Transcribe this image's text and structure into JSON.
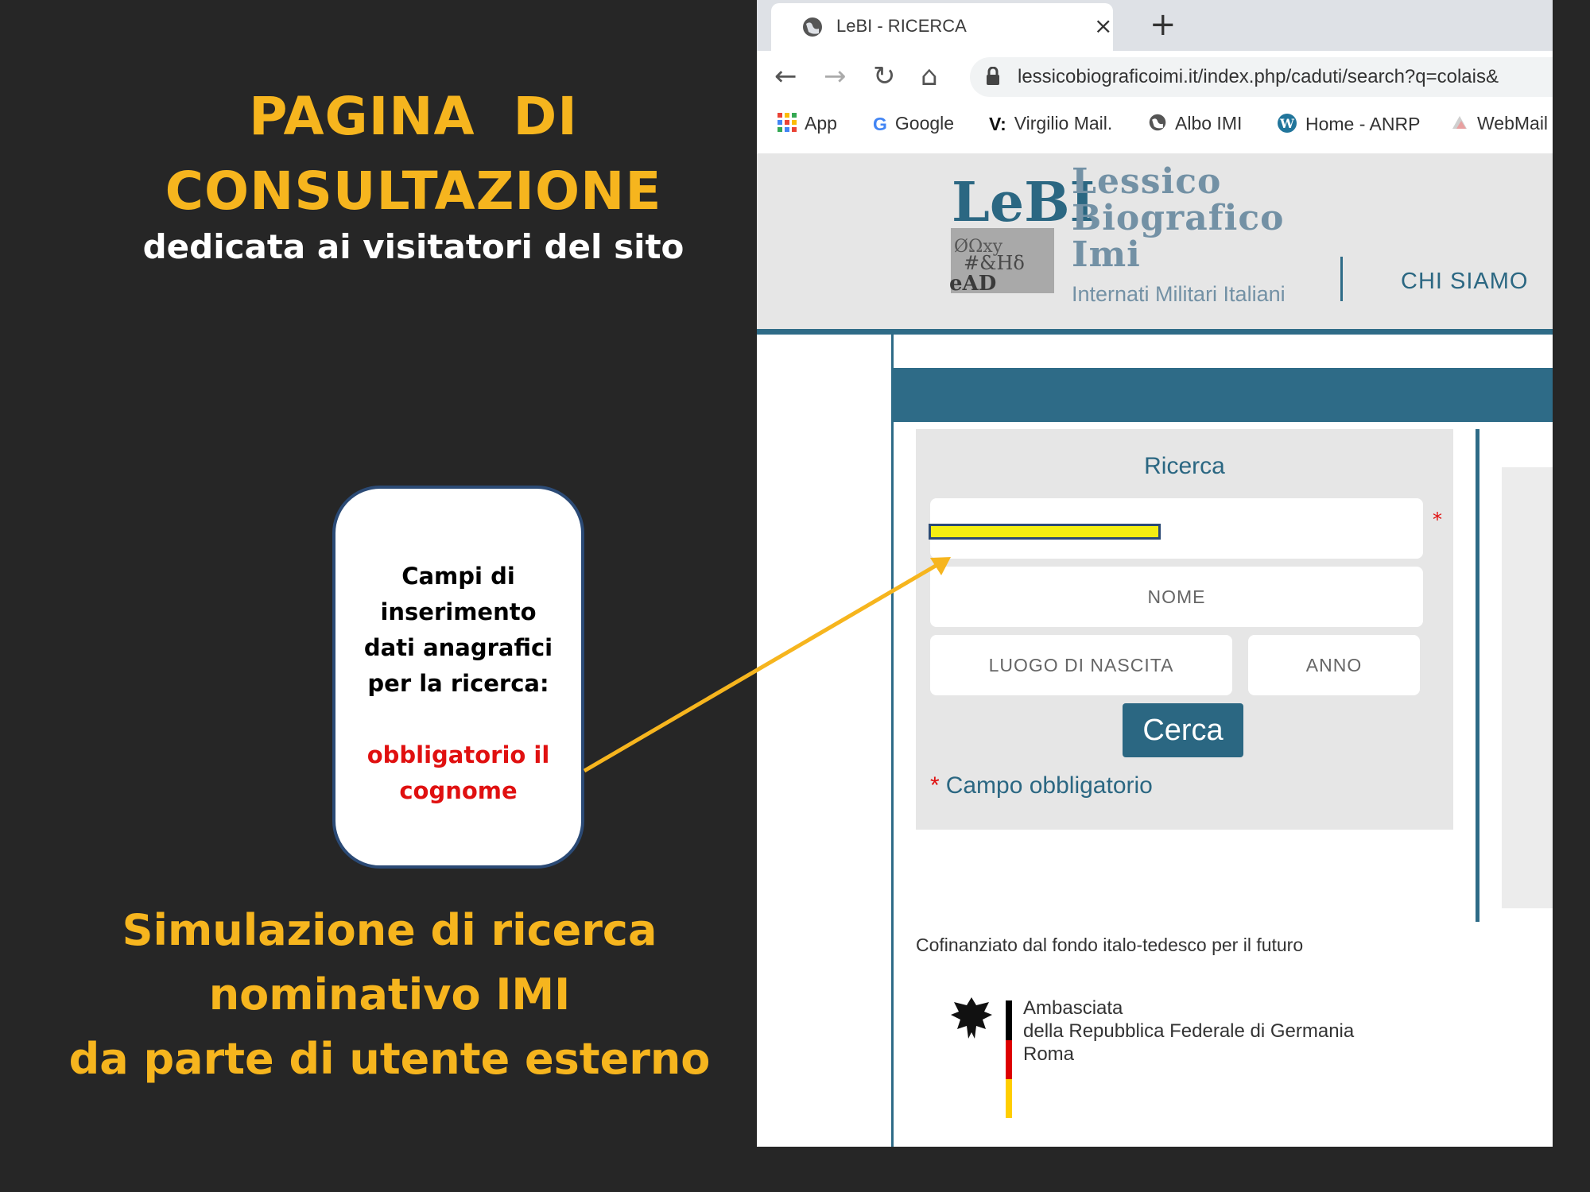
{
  "slide": {
    "title_line1": "PAGINA  DI",
    "title_line2": "CONSULTAZIONE",
    "subtitle": "dedicata ai visitatori del sito",
    "callout": {
      "line1": "Campi di",
      "line2": "inserimento",
      "line3": "dati anagrafici",
      "line4": "per la ricerca:",
      "red_line1": "obbligatorio il",
      "red_line2": "cognome"
    },
    "caption_line1": "Simulazione di ricerca",
    "caption_line2": "nominativo IMI",
    "caption_line3": "da parte di utente esterno",
    "colors": {
      "accent": "#f6b51e",
      "background": "#262626",
      "required": "#e01010"
    }
  },
  "browser": {
    "tab_title": "LeBI - RICERCA",
    "tab_close": "×",
    "new_tab": "+",
    "url": "lessicobiograficoimi.it/index.php/caduti/search?q=colais&",
    "nav": {
      "back": "←",
      "forward": "→",
      "reload": "↻",
      "home": "⌂"
    },
    "bookmarks": [
      "App",
      "Google",
      "Virgilio Mail.",
      "Albo IMI",
      "Home - ANRP",
      "WebMail"
    ],
    "bookmark_prefix_v": "V:"
  },
  "site": {
    "logo": {
      "mark": "LeBI",
      "word1": "Lessico",
      "word2": "Biografico",
      "word3": "Imi",
      "subtitle": "Internati Militari Italiani"
    },
    "nav_chi_siamo": "CHI SIAMO",
    "search": {
      "title": "Ricerca",
      "field_nome": "NOME",
      "field_luogo": "LUOGO DI NASCITA",
      "field_anno": "ANNO",
      "button": "Cerca",
      "required_star": "*",
      "mandatory_note": "Campo obbligatorio"
    },
    "footer": {
      "cofinanziato": "Cofinanziato dal fondo italo-tedesco per il futuro",
      "embassy_line1": "Ambasciata",
      "embassy_line2": "della Repubblica Federale di Germania",
      "embassy_line3": "Roma"
    },
    "colors": {
      "primary": "#2e6b87",
      "header_bg": "#e6e6e6",
      "highlight": "#f3ee12"
    }
  }
}
